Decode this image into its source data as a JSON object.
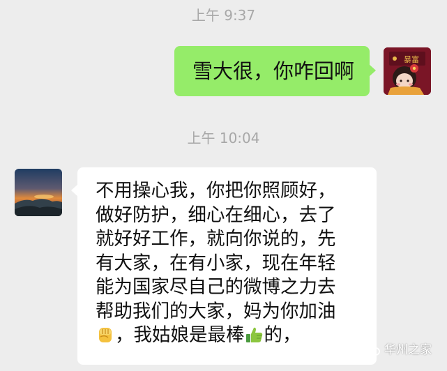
{
  "chat": {
    "messages": [
      {
        "timestamp": "上午 9:37",
        "direction": "outgoing",
        "text": "雪大很，你咋回啊"
      },
      {
        "timestamp": "上午 10:04",
        "direction": "incoming",
        "lines": [
          "不用操心我，你把你照顾好，",
          "做好防护，细心在细心，去了",
          "就好好工作，就向你说的，先",
          "有大家，在有小家，现在年轻",
          "能为国家尽自己的微博之力去",
          "帮助我们的大家，妈为你加油"
        ],
        "last_line_parts": [
          "，我姑娘是最棒",
          "的，"
        ],
        "emojis": [
          "raised-fist-emoji",
          "thumbs-up-emoji"
        ]
      }
    ]
  },
  "watermark": {
    "text": "华州之家",
    "icon": "wechat-channel-icon"
  },
  "colors": {
    "background": "#ededed",
    "outgoing_bubble": "#95ec69",
    "incoming_bubble": "#ffffff",
    "timestamp": "#a8a8a8"
  }
}
